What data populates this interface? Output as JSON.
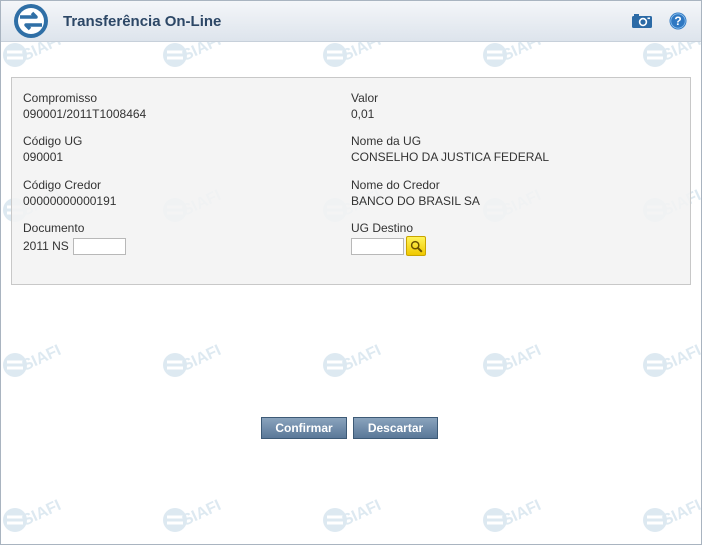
{
  "header": {
    "title": "Transferência On-Line"
  },
  "fields": {
    "compromisso": {
      "label": "Compromisso",
      "value": "090001/2011T1008464"
    },
    "valor": {
      "label": "Valor",
      "value": "0,01"
    },
    "codigo_ug": {
      "label": "Código UG",
      "value": "090001"
    },
    "nome_ug": {
      "label": "Nome da UG",
      "value": "CONSELHO DA JUSTICA FEDERAL"
    },
    "codigo_credor": {
      "label": "Código Credor",
      "value": "00000000000191"
    },
    "nome_credor": {
      "label": "Nome do Credor",
      "value": "BANCO DO BRASIL SA"
    },
    "documento": {
      "label": "Documento",
      "prefix": "2011 NS",
      "input_value": ""
    },
    "ug_destino": {
      "label": "UG Destino",
      "input_value": ""
    }
  },
  "buttons": {
    "confirm": "Confirmar",
    "discard": "Descartar"
  },
  "icons": {
    "logo": "siafi-logo-icon",
    "camera": "camera-icon",
    "help": "help-icon",
    "search": "search-icon"
  },
  "colors": {
    "title": "#2c4766",
    "button": "#6a86a5",
    "search_button": "#f5d800"
  }
}
